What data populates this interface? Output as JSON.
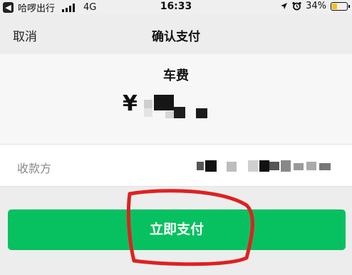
{
  "status_bar": {
    "back_app": "哈啰出行",
    "network": "4G",
    "time": "16:33",
    "battery": "34%",
    "battery_level": 0.34,
    "icons": [
      "location-arrow-icon",
      "alarm-icon",
      "battery-icon",
      "signal-icon"
    ]
  },
  "nav": {
    "cancel": "取消",
    "title": "确认支付"
  },
  "payment": {
    "label": "车费",
    "currency": "¥",
    "amount_obscured": true
  },
  "payee": {
    "label": "收款方",
    "name_obscured": true
  },
  "pay_button": {
    "label": "立即支付"
  },
  "colors": {
    "primary_green": "#07c160",
    "annotation_red": "#e02020",
    "battery_yellow": "#f3c315"
  }
}
